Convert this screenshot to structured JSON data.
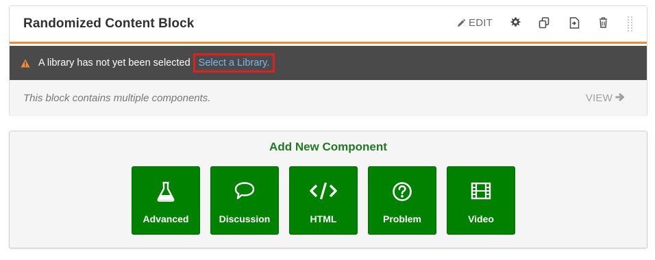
{
  "block": {
    "title": "Randomized Content Block",
    "edit_label": "EDIT",
    "icons": [
      "pencil-icon",
      "gear-icon",
      "duplicate-icon",
      "move-icon",
      "trash-icon",
      "drag-handle-icon"
    ]
  },
  "warning": {
    "message": "A library has not yet been selected",
    "link_label": "Select a Library.",
    "icon": "warning-triangle-icon",
    "accent_color": "#f08b31"
  },
  "description": {
    "text": "This block contains multiple components.",
    "view_label": "VIEW"
  },
  "add_component": {
    "title": "Add New Component",
    "button_color": "#008100",
    "buttons": [
      {
        "label": "Advanced",
        "icon": "flask-icon"
      },
      {
        "label": "Discussion",
        "icon": "speech-bubble-icon"
      },
      {
        "label": "HTML",
        "icon": "code-icon"
      },
      {
        "label": "Problem",
        "icon": "question-circle-icon"
      },
      {
        "label": "Video",
        "icon": "film-icon"
      }
    ]
  }
}
